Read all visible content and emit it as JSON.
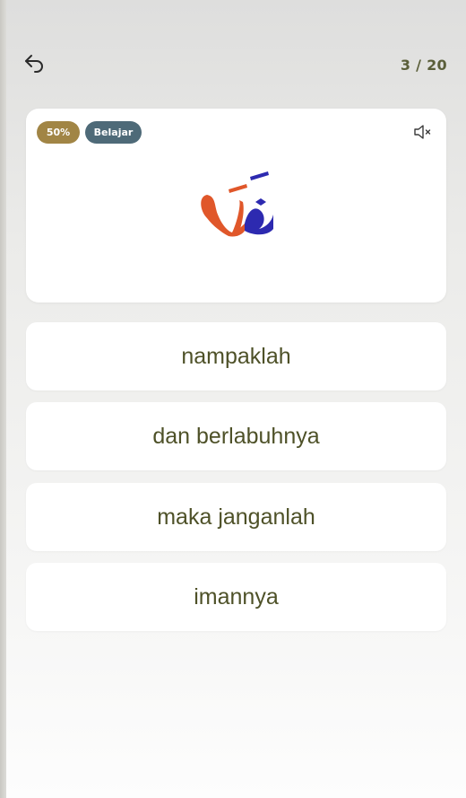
{
  "header": {
    "back_icon": "undo-arrow-icon",
    "progress": "3 / 20"
  },
  "card": {
    "percent_badge": "50%",
    "mode_badge": "Belajar",
    "mute_icon": "speaker-muted-icon",
    "arabic_word": "فَلَا",
    "colors": {
      "first_letter": "#e0572a",
      "second_letter": "#2d2ab0"
    }
  },
  "options": [
    {
      "label": "nampaklah"
    },
    {
      "label": "dan berlabuhnya"
    },
    {
      "label": "maka janganlah"
    },
    {
      "label": "imannya"
    }
  ],
  "colors": {
    "badge_percent": "#a18545",
    "badge_mode": "#4e6a78",
    "option_text": "#4e5128",
    "progress_text": "#5b5f3a"
  }
}
